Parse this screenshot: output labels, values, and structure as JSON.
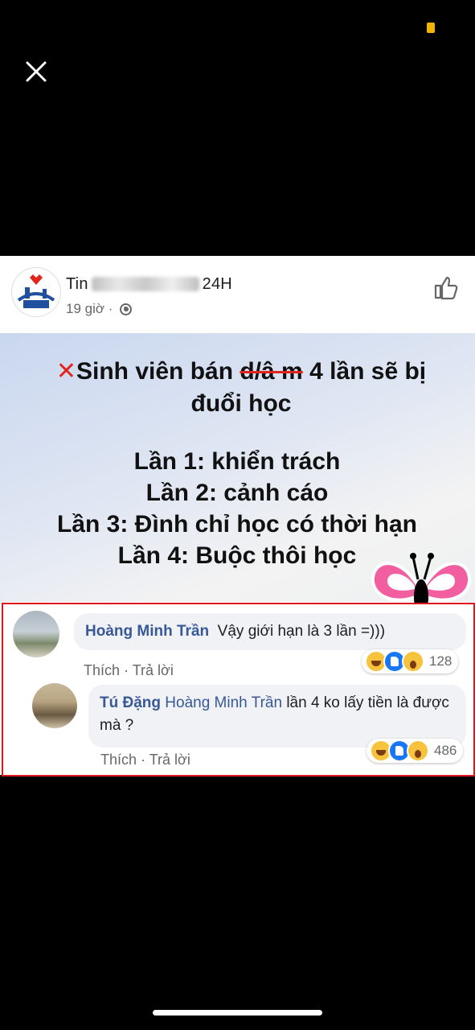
{
  "post": {
    "page_name_prefix": "Tin",
    "page_name_suffix": "24H",
    "time": "19 giờ ·",
    "image": {
      "headline_x": "✕",
      "headline_start": "Sinh viên bán ",
      "headline_struck": "d/â m",
      "headline_end": " 4 lần sẽ bị đuổi học",
      "rules": [
        "Lần 1: khiển trách",
        "Lần 2: cảnh cáo",
        "Lần 3: Đình chỉ học có thời hạn",
        "Lần 4: Buộc thôi học"
      ]
    }
  },
  "comments": [
    {
      "author": "Hoàng Minh Trần",
      "text": "Vậy giới hạn là 3 lần =)))",
      "like_label": "Thích",
      "reply_label": "Trả lời",
      "reaction_count": "128",
      "reactions": [
        "haha-icon",
        "like-icon",
        "wow-icon"
      ]
    },
    {
      "author": "Tú Đặng",
      "mention": "Hoàng Minh Trần",
      "text": "lần 4 ko lấy tiền là được mà ?",
      "like_label": "Thích",
      "reply_label": "Trả lời",
      "reaction_count": "486",
      "reactions": [
        "haha-icon",
        "like-icon",
        "wow-icon"
      ]
    }
  ],
  "colors": {
    "highlight_border": "#e0161c",
    "name_link": "#385898",
    "strike_red": "#e0241b"
  }
}
